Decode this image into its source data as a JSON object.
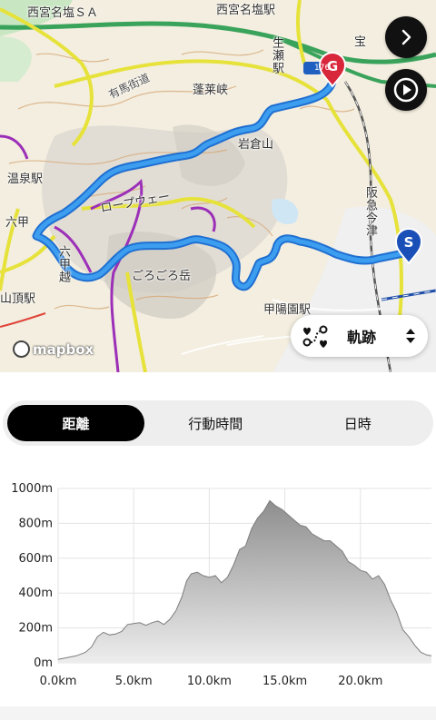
{
  "map": {
    "labels": {
      "nishinomiya_sa": "西宮名塩ＳＡ",
      "nishinomiya_station": "西宮名塩駅",
      "arima_kaido": "有馬街道",
      "horaikyo": "蓬莱峡",
      "namaze_station": "生瀬駅",
      "iwakurayama": "岩倉山",
      "onsen_station": "温泉駅",
      "rokko": "六甲",
      "rokkoetsu": "六甲越",
      "ropeway": "ロープウェー",
      "gorogorodake": "ごろごろ岳",
      "hankyu_imazu": "阪急今津",
      "koyoen_station": "甲陽園駅",
      "sanchoeki": "山頂駅",
      "route_num": "176",
      "kabuto": "宝",
      "mapbox": "mapbox"
    },
    "markers": {
      "start": "S",
      "goal": "G"
    },
    "track_color": "#2c8fe8",
    "icons": [
      "chevron-right-icon",
      "play-icon",
      "route-icon",
      "sort-icon",
      "mapbox-logo-icon"
    ]
  },
  "track_selector": {
    "label": "軌跡"
  },
  "tabs": [
    {
      "label": "距離",
      "active": true
    },
    {
      "label": "行動時間",
      "active": false
    },
    {
      "label": "日時",
      "active": false
    }
  ],
  "chart_data": {
    "type": "area",
    "title": "",
    "xlabel": "",
    "ylabel": "",
    "x_unit": "km",
    "y_unit": "m",
    "xlim": [
      0,
      24.7
    ],
    "ylim": [
      0,
      1000
    ],
    "x_ticks": [
      "0.0km",
      "5.0km",
      "10.0km",
      "15.0km",
      "20.0km"
    ],
    "y_ticks": [
      "0m",
      "200m",
      "400m",
      "600m",
      "800m",
      "1000m"
    ],
    "x_tick_values": [
      0,
      5,
      10,
      15,
      20
    ],
    "y_tick_values": [
      0,
      200,
      400,
      600,
      800,
      1000
    ],
    "grid": true,
    "fill_color": "#9a9a9a",
    "series": [
      {
        "x": [
          0,
          0.6,
          1.2,
          1.8,
          2.2,
          2.6,
          3.0,
          3.4,
          3.8,
          4.2,
          4.6,
          5.0,
          5.4,
          5.8,
          6.2,
          6.6,
          7.0,
          7.4,
          7.8,
          8.2,
          8.5,
          8.8,
          9.2,
          9.6,
          10.0,
          10.4,
          10.8,
          11.2,
          11.6,
          12.0,
          12.4,
          12.8,
          13.2,
          13.6,
          14.0,
          14.4,
          14.8,
          15.2,
          15.6,
          16.0,
          16.4,
          16.8,
          17.2,
          17.6,
          18.0,
          18.4,
          18.8,
          19.2,
          19.6,
          20.0,
          20.4,
          20.8,
          21.2,
          21.6,
          22.0,
          22.4,
          22.8,
          23.2,
          23.6,
          24.0,
          24.4,
          24.7
        ],
        "values": [
          20,
          30,
          40,
          60,
          90,
          150,
          175,
          160,
          165,
          180,
          220,
          225,
          230,
          215,
          230,
          240,
          220,
          250,
          300,
          380,
          470,
          510,
          520,
          500,
          490,
          500,
          460,
          490,
          560,
          650,
          670,
          770,
          830,
          870,
          930,
          900,
          880,
          850,
          820,
          790,
          780,
          740,
          720,
          700,
          700,
          670,
          640,
          580,
          560,
          530,
          520,
          480,
          500,
          450,
          360,
          290,
          190,
          150,
          100,
          60,
          45,
          40
        ]
      }
    ]
  }
}
